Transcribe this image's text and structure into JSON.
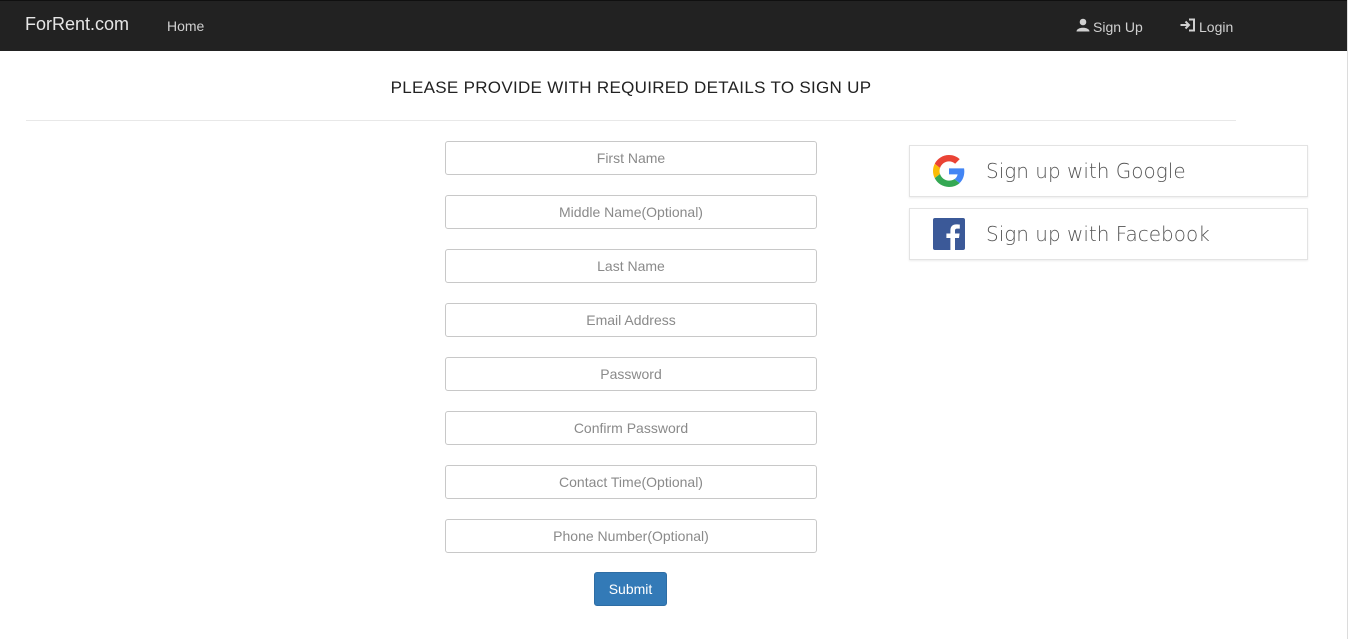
{
  "navbar": {
    "brand": "ForRent.com",
    "home": "Home",
    "signup": "Sign Up",
    "login": "Login"
  },
  "heading": "PLEASE PROVIDE WITH REQUIRED DETAILS TO SIGN UP",
  "form": {
    "first_name": {
      "placeholder": "First Name",
      "value": ""
    },
    "middle_name": {
      "placeholder": "Middle Name(Optional)",
      "value": ""
    },
    "last_name": {
      "placeholder": "Last Name",
      "value": ""
    },
    "email": {
      "placeholder": "Email Address",
      "value": ""
    },
    "password": {
      "placeholder": "Password",
      "value": ""
    },
    "confirm_password": {
      "placeholder": "Confirm Password",
      "value": ""
    },
    "contact_time": {
      "placeholder": "Contact Time(Optional)",
      "value": ""
    },
    "phone": {
      "placeholder": "Phone Number(Optional)",
      "value": ""
    },
    "submit": "Submit"
  },
  "social": {
    "google": {
      "label": "Sign up with Google",
      "icon": "google-icon"
    },
    "facebook": {
      "label": "Sign up with Facebook",
      "icon": "facebook-icon"
    }
  },
  "colors": {
    "navbar_bg": "#222222",
    "primary": "#337ab7",
    "facebook": "#3b5998"
  }
}
